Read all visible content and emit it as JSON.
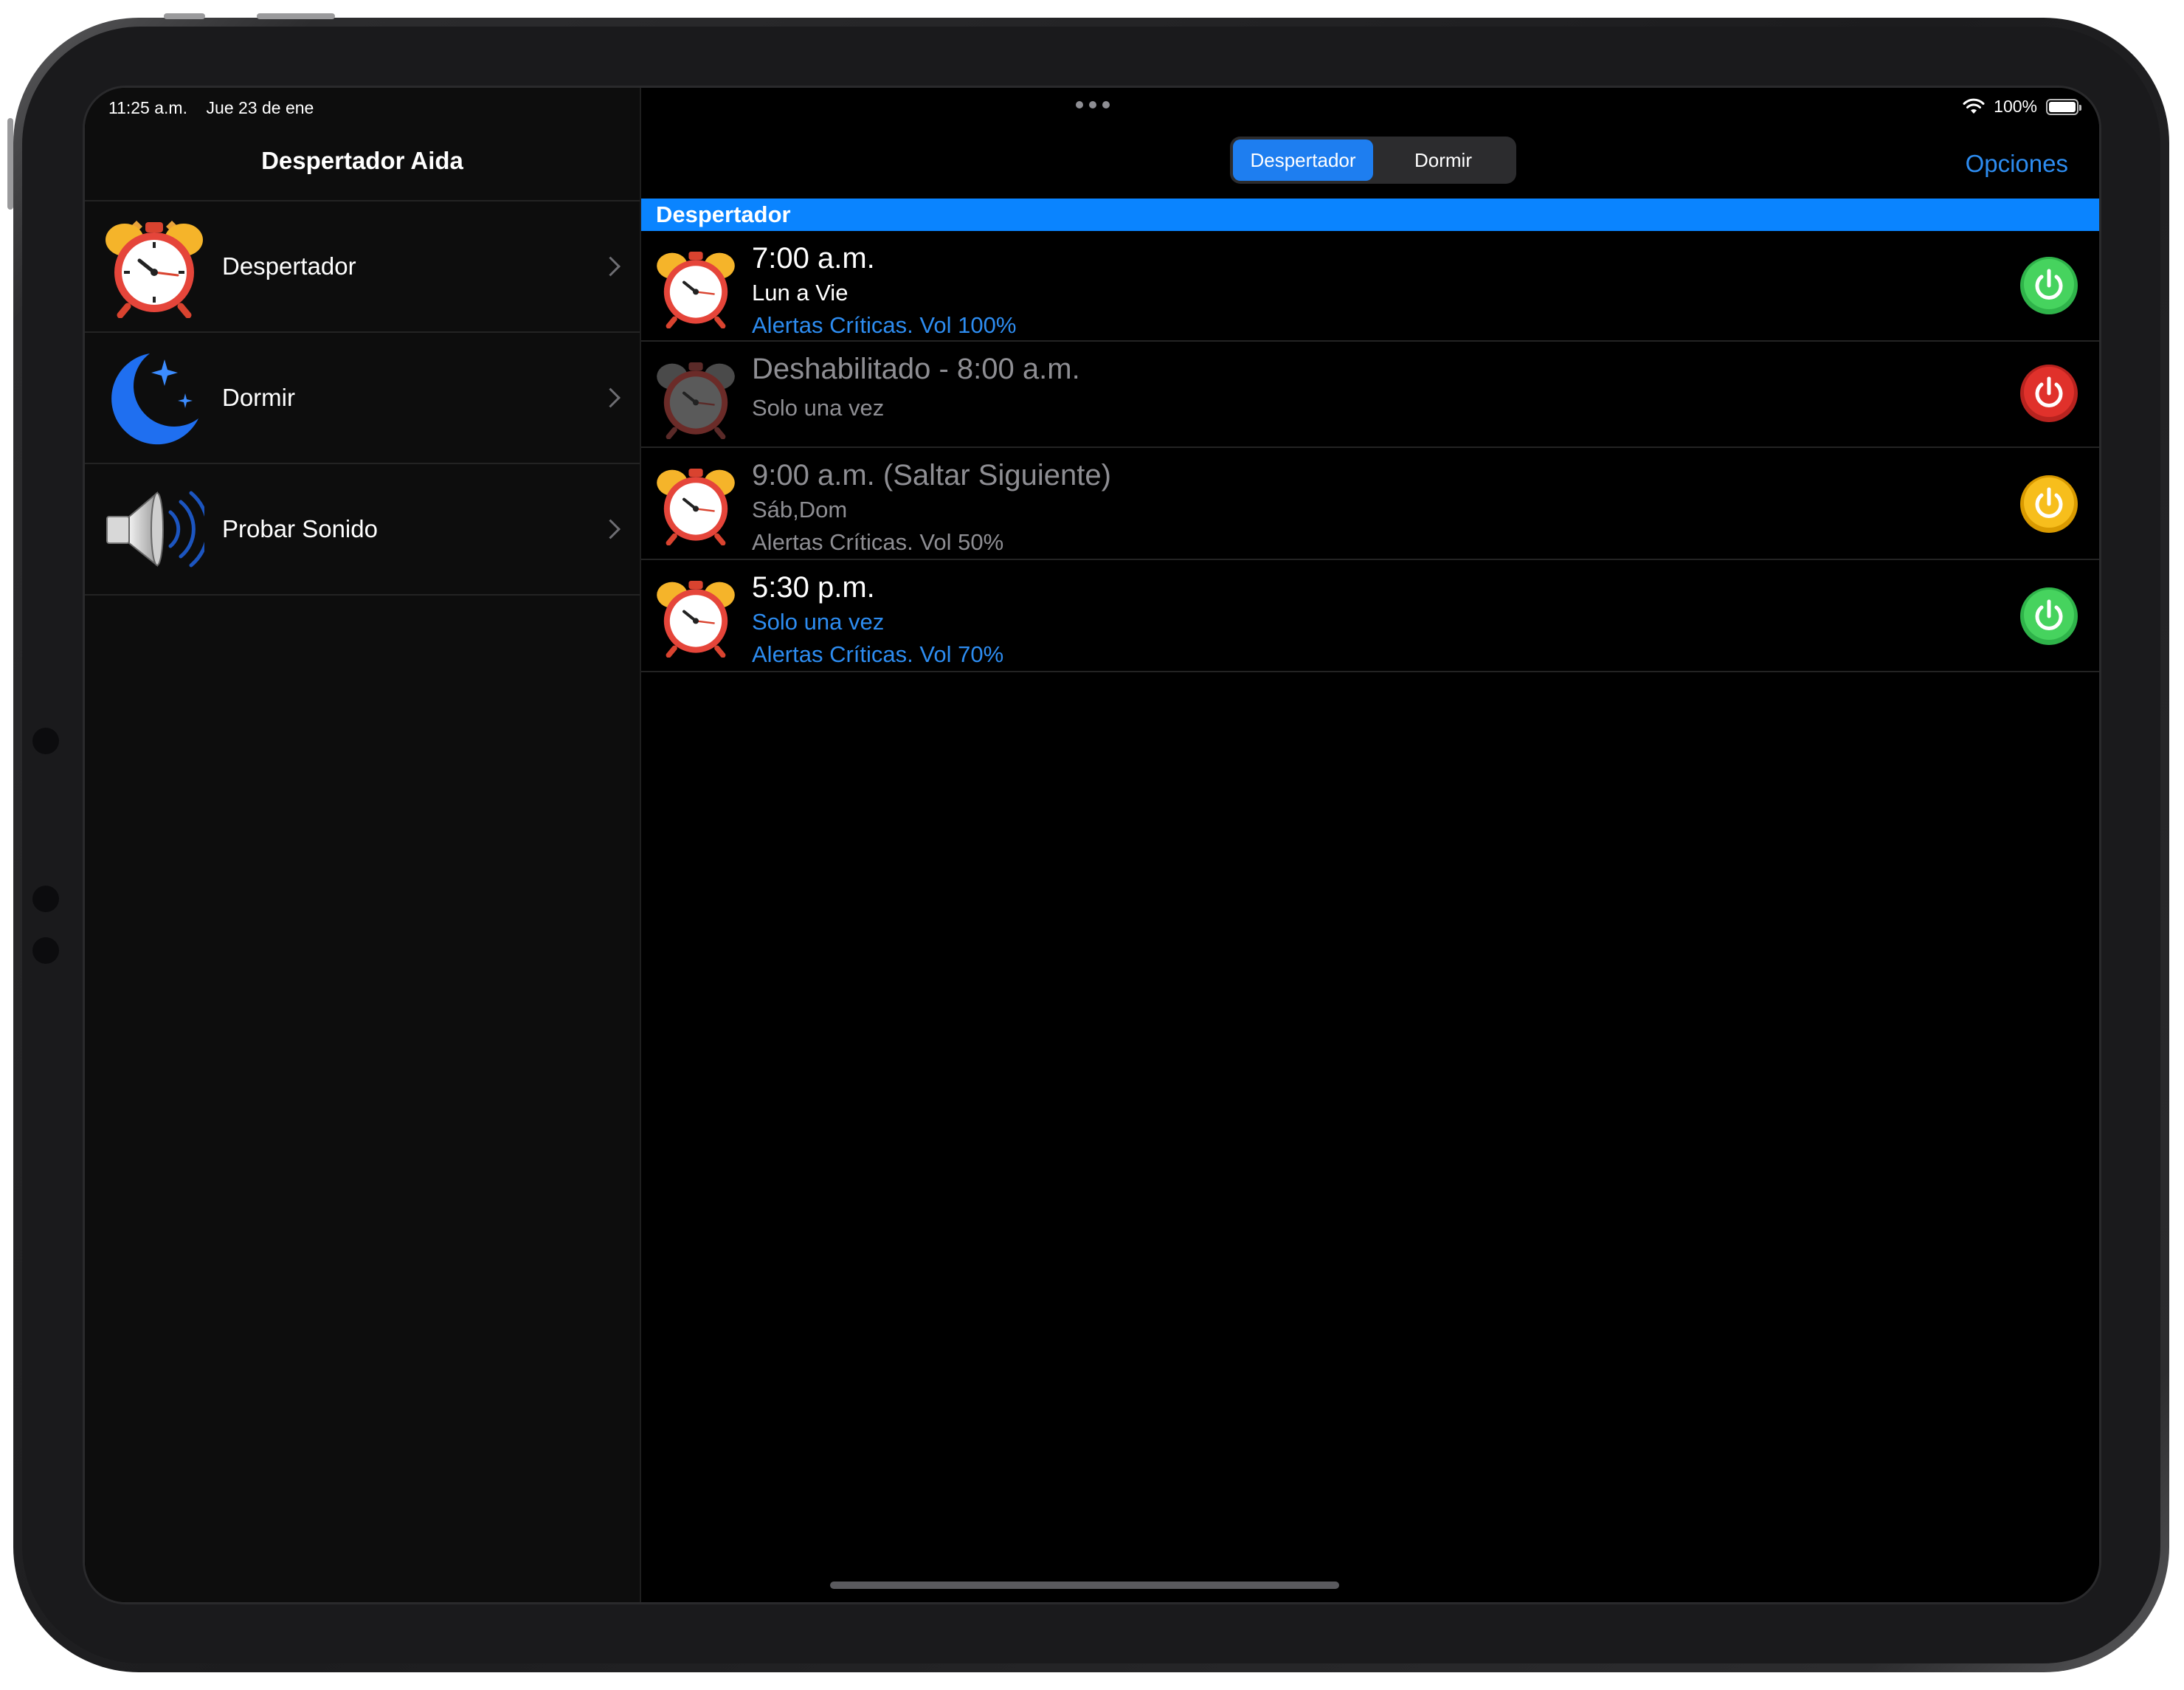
{
  "status": {
    "time": "11:25 a.m.",
    "date": "Jue 23 de ene",
    "battery": "100%",
    "battery_level": 1.0
  },
  "sidebar": {
    "title": "Despertador Aida",
    "items": [
      {
        "label": "Despertador",
        "icon": "alarm-clock-icon"
      },
      {
        "label": "Dormir",
        "icon": "moon-stars-icon"
      },
      {
        "label": "Probar Sonido",
        "icon": "speaker-icon"
      }
    ]
  },
  "toolbar": {
    "segments": [
      "Despertador",
      "Dormir"
    ],
    "selected_segment": "Despertador",
    "options_label": "Opciones"
  },
  "section": {
    "title": "Despertador"
  },
  "alarms": [
    {
      "title": "7:00 a.m.",
      "subtitle": "Lun a Vie",
      "detail": "Alertas Críticas. Vol 100%",
      "state": "enabled",
      "power_color": "#34c759"
    },
    {
      "title": "Deshabilitado - 8:00 a.m.",
      "subtitle": "Solo una vez",
      "detail": "",
      "state": "disabled",
      "power_color": "#e0312b"
    },
    {
      "title": "9:00 a.m. (Saltar Siguiente)",
      "subtitle": "Sáb,Dom",
      "detail": "Alertas Críticas. Vol 50%",
      "state": "skip",
      "power_color": "#f5b800"
    },
    {
      "title": "5:30 p.m.",
      "subtitle": "Solo una vez",
      "detail": "Alertas Críticas. Vol 70%",
      "state": "enabled",
      "power_color": "#34c759"
    }
  ],
  "colors": {
    "accent": "#0a84ff",
    "link": "#2d8cf0",
    "background": "#000000"
  }
}
